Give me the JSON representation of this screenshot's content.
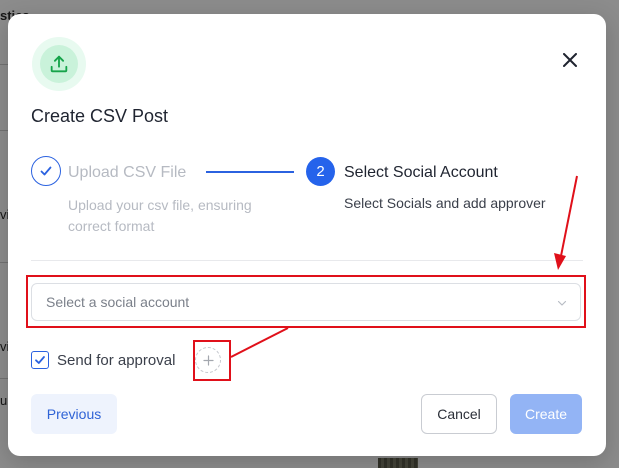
{
  "background": {
    "fragment_top": "stics",
    "fragment_left_1": "vi",
    "fragment_left_2": "vi",
    "fragment_left_3": "u"
  },
  "modal": {
    "icon": "upload-icon",
    "title": "Create CSV Post",
    "close_icon": "close-icon"
  },
  "stepper": {
    "steps": [
      {
        "status": "completed",
        "title": "Upload CSV File",
        "description": "Upload your csv file, ensuring correct format"
      },
      {
        "status": "active",
        "number": "2",
        "title": "Select Social Account",
        "description": "Select Socials and add approver"
      }
    ]
  },
  "form": {
    "social_select": {
      "placeholder": "Select a social account",
      "value": ""
    },
    "approval": {
      "checked": true,
      "label": "Send for approval",
      "add_icon": "plus-icon"
    }
  },
  "footer": {
    "previous_label": "Previous",
    "cancel_label": "Cancel",
    "create_label": "Create",
    "create_enabled": false
  },
  "colors": {
    "primary": "#2563eb",
    "success_bg": "#e8faf0",
    "success_icon": "#16a34a",
    "annotation": "#e0101a",
    "create_disabled": "#93b4f5"
  }
}
